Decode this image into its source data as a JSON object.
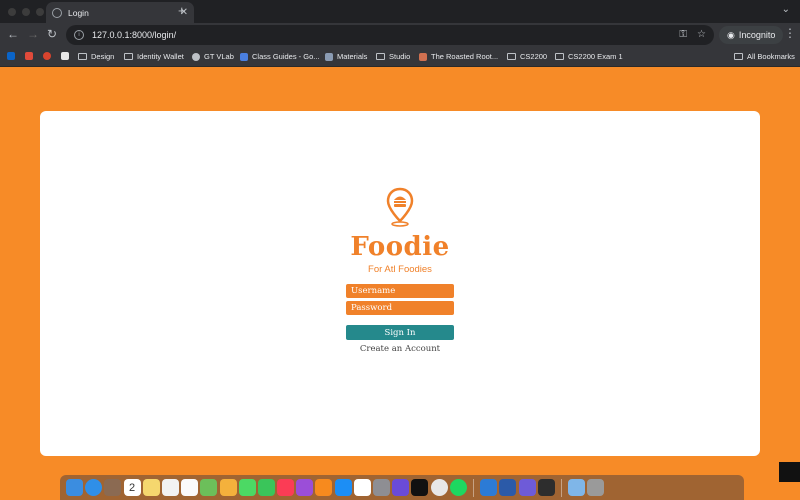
{
  "browser": {
    "tab_title": "Login",
    "url": "127.0.0.1:8000/login/",
    "incognito_label": "Incognito",
    "bookmarks": [
      {
        "label": "Design",
        "type": "folder"
      },
      {
        "label": "Identity Wallet",
        "type": "folder"
      },
      {
        "label": "GT VLab",
        "type": "site"
      },
      {
        "label": "Class Guides - Go...",
        "type": "site"
      },
      {
        "label": "Materials",
        "type": "site"
      },
      {
        "label": "Studio",
        "type": "folder"
      },
      {
        "label": "The Roasted Root...",
        "type": "site"
      },
      {
        "label": "CS2200",
        "type": "folder"
      },
      {
        "label": "CS2200 Exam 1",
        "type": "folder"
      }
    ],
    "all_bookmarks_label": "All Bookmarks"
  },
  "page": {
    "brand": "Foodie",
    "tagline": "For Atl Foodies",
    "username_placeholder": "Username",
    "password_placeholder": "Password",
    "signin_label": "Sign In",
    "create_account_label": "Create an Account"
  },
  "dock": {
    "calendar_day": "2",
    "icons": [
      "finder-icon",
      "safari-icon",
      "launchpad-icon",
      "calendar-icon",
      "notes-icon",
      "freeform-icon",
      "reminders-icon",
      "maps-icon",
      "photos-icon",
      "messages-icon",
      "facetime-icon",
      "music-icon",
      "podcasts-icon",
      "books-icon",
      "appstore-icon",
      "slack-icon",
      "settings-icon",
      "imovie-icon",
      "appletv-icon",
      "chrome-icon",
      "spotify-icon",
      "vscode-icon",
      "word-icon",
      "github-icon",
      "cursor-icon"
    ]
  },
  "colors": {
    "page_bg": "#f78b27",
    "brand": "#f0812a",
    "signin_bg": "#25898c"
  }
}
